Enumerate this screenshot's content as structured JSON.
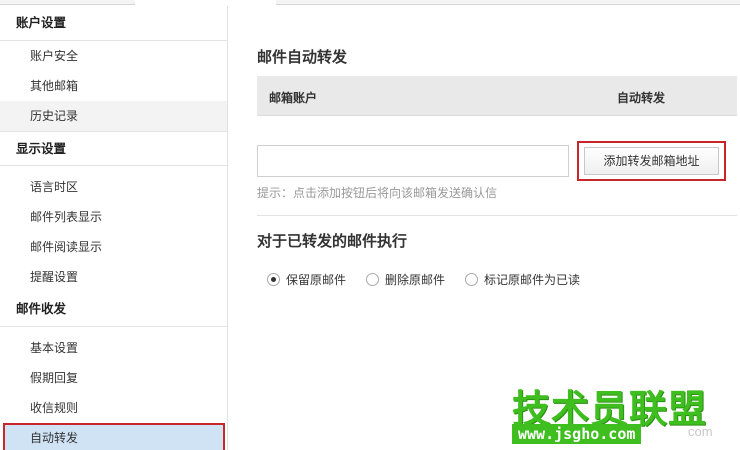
{
  "sidebar": {
    "sections": [
      {
        "title": "账户设置",
        "items": [
          "账户安全",
          "其他邮箱",
          "历史记录"
        ]
      },
      {
        "title": "显示设置",
        "items": [
          "语言时区",
          "邮件列表显示",
          "邮件阅读显示",
          "提醒设置"
        ]
      },
      {
        "title": "邮件收发",
        "items": [
          "基本设置",
          "假期回复",
          "收信规则",
          "自动转发"
        ]
      }
    ],
    "hovered_item": "历史记录",
    "active_item": "自动转发"
  },
  "main": {
    "title": "邮件自动转发",
    "table": {
      "col_account": "邮箱账户",
      "col_forward": "自动转发"
    },
    "input": {
      "value": "",
      "placeholder": ""
    },
    "add_button": "添加转发邮箱地址",
    "hint": "提示：点击添加按钮后将向该邮箱发送确认信",
    "action_title": "对于已转发的邮件执行",
    "options": [
      {
        "label": "保留原邮件",
        "selected": true
      },
      {
        "label": "删除原邮件",
        "selected": false
      },
      {
        "label": "标记原邮件为已读",
        "selected": false
      }
    ]
  },
  "watermark": {
    "title": "技术员联盟",
    "url": "www.jsgho.com",
    "tail": "com"
  },
  "colors": {
    "highlight_border": "#c9262c",
    "active_item_bg": "#cfe3f5",
    "watermark_green": "#3fbf1f"
  }
}
